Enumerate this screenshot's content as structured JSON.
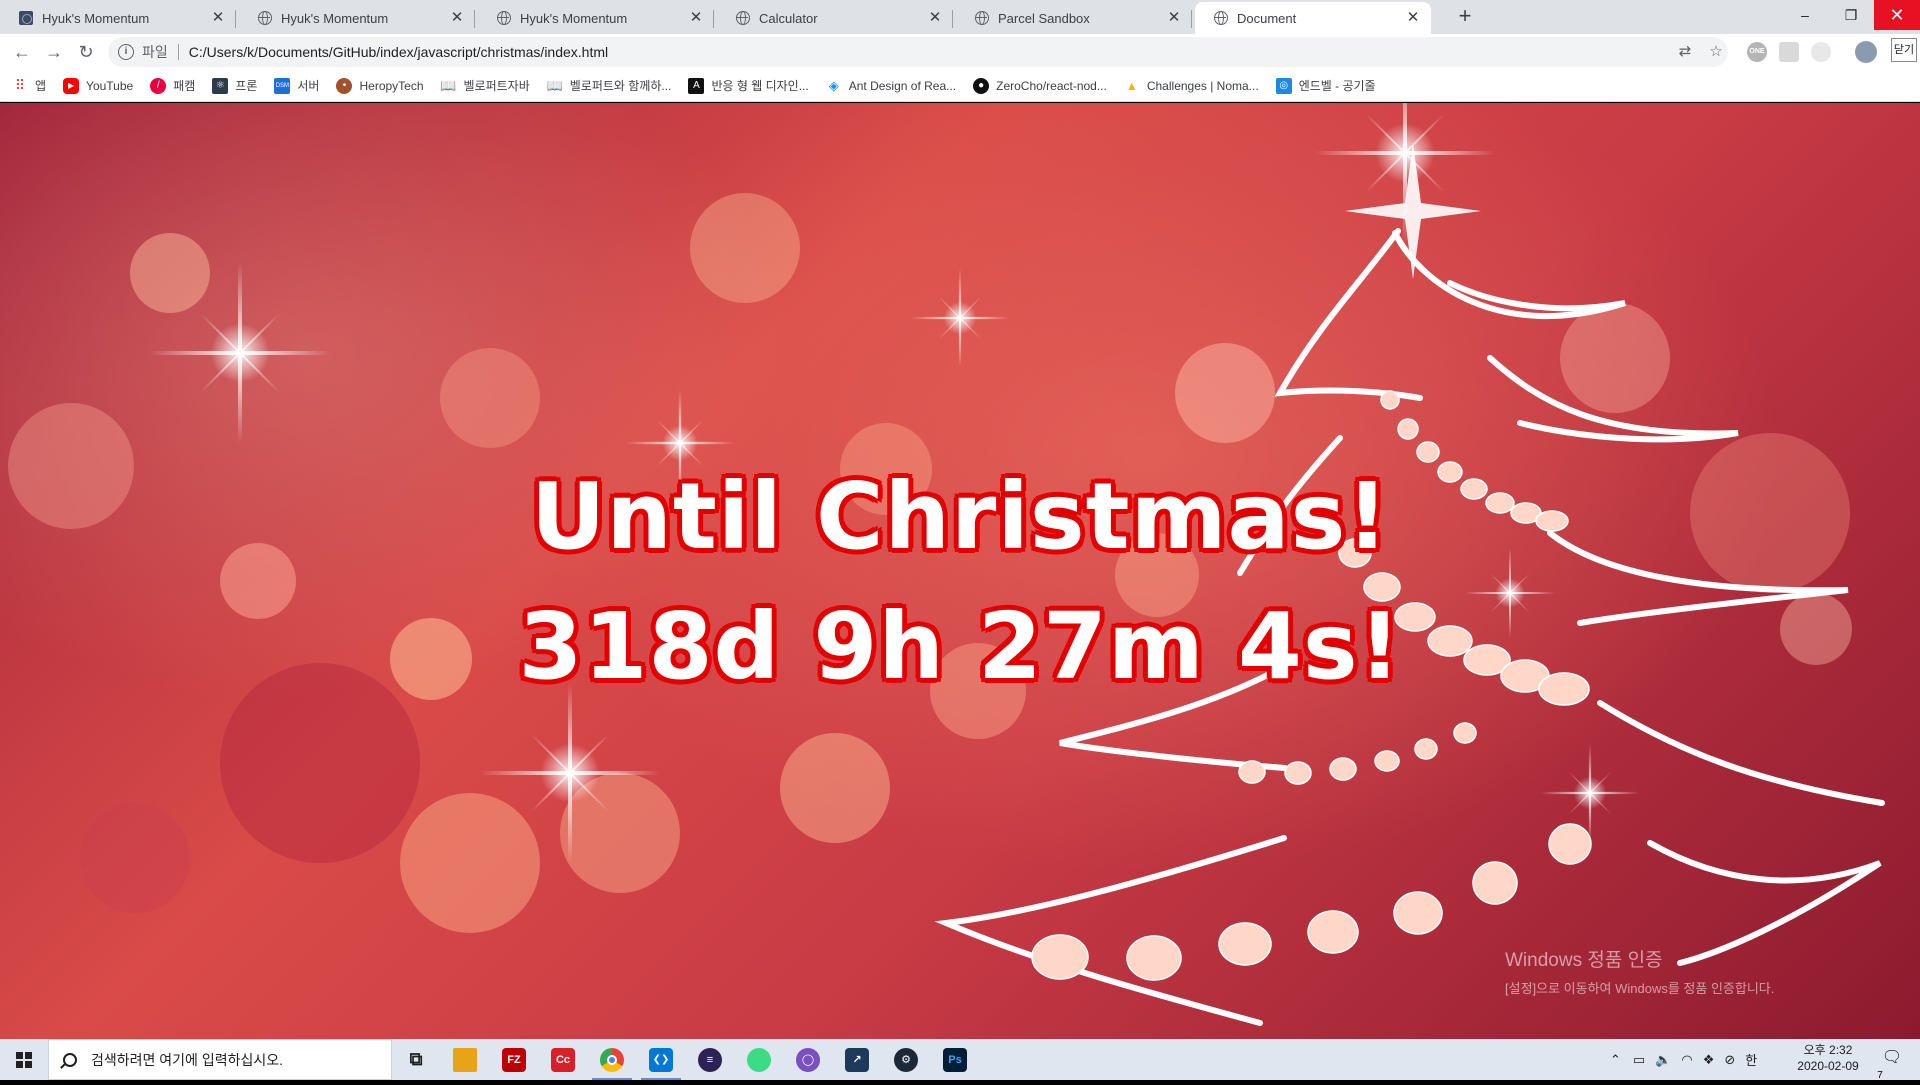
{
  "browser": {
    "tabs": [
      {
        "title": "Hyuk's Momentum",
        "icon": "momentum-icon",
        "active": false
      },
      {
        "title": "Hyuk's Momentum",
        "icon": "globe-icon",
        "active": false
      },
      {
        "title": "Hyuk's Momentum",
        "icon": "globe-icon",
        "active": false
      },
      {
        "title": "Calculator",
        "icon": "globe-icon",
        "active": false
      },
      {
        "title": "Parcel Sandbox",
        "icon": "globe-icon",
        "active": false
      },
      {
        "title": "Document",
        "icon": "globe-icon",
        "active": true
      }
    ],
    "new_tab": "+",
    "window_controls": {
      "minimize": "–",
      "maximize": "❐",
      "close": "✕"
    },
    "address": {
      "scheme_label": "파일",
      "url": "C:/Users/k/Documents/GitHub/index/javascript/christmas/index.html"
    },
    "menu_label": "닫기",
    "bookmarks": [
      {
        "label": "앱",
        "icon": "apps-grid-icon",
        "color": "#ea4335"
      },
      {
        "label": "YouTube",
        "icon": "youtube-icon",
        "color": "#ff0000"
      },
      {
        "label": "패캠",
        "icon": "fastcampus-icon",
        "color": "#e8003d"
      },
      {
        "label": "프론",
        "icon": "react-icon",
        "color": "#2d3b4f"
      },
      {
        "label": "서버",
        "icon": "dsm-icon",
        "color": "#1e6fd9"
      },
      {
        "label": "HeropyTech",
        "icon": "heropy-icon",
        "color": "#a0522d"
      },
      {
        "label": "벨로퍼트자바",
        "icon": "book-icon",
        "color": "#444444"
      },
      {
        "label": "벨로퍼트와 함께하...",
        "icon": "book-icon",
        "color": "#444444"
      },
      {
        "label": "반응 형 웹 디자인...",
        "icon": "adobe-icon",
        "color": "#111111"
      },
      {
        "label": "Ant Design of Rea...",
        "icon": "antdesign-icon",
        "color": "#1890ff"
      },
      {
        "label": "ZeroCho/react-nod...",
        "icon": "github-icon",
        "color": "#111111"
      },
      {
        "label": "Challenges | Noma...",
        "icon": "nomad-icon",
        "color": "#f2b705"
      },
      {
        "label": "엔드벨 - 공기줄",
        "icon": "endbell-icon",
        "color": "#1e88e5"
      }
    ]
  },
  "page": {
    "headline": "Until Christmas!",
    "countdown": "318d 9h 27m 4s!",
    "activation_title": "Windows 정품 인증",
    "activation_sub": "[설정]으로 이동하여 Windows를 정품 인증합니다."
  },
  "taskbar": {
    "search_placeholder": "검색하려면 여기에 입력하십시오.",
    "apps": [
      {
        "name": "task-view-icon",
        "color": "#202020",
        "glyph": "⧉",
        "running": false
      },
      {
        "name": "file-explorer-icon",
        "color": "#e8a317",
        "glyph": "",
        "running": false
      },
      {
        "name": "filezilla-icon",
        "color": "#bf0000",
        "glyph": "FZ",
        "running": false
      },
      {
        "name": "creative-cloud-icon",
        "color": "#da1f26",
        "glyph": "Cc",
        "running": false
      },
      {
        "name": "chrome-icon",
        "color": "#4285f4",
        "glyph": "",
        "running": true
      },
      {
        "name": "vscode-icon",
        "color": "#0078d4",
        "glyph": "❮❯",
        "running": true
      },
      {
        "name": "eclipse-icon",
        "color": "#2c2255",
        "glyph": "",
        "running": false
      },
      {
        "name": "android-studio-icon",
        "color": "#3ddc84",
        "glyph": "",
        "running": false
      },
      {
        "name": "cursor-app-icon",
        "color": "#7a4fbf",
        "glyph": "",
        "running": false
      },
      {
        "name": "netbeans-icon",
        "color": "#1b3a5c",
        "glyph": "",
        "running": false
      },
      {
        "name": "steam-icon",
        "color": "#1b2838",
        "glyph": "",
        "running": false
      },
      {
        "name": "photoshop-icon",
        "color": "#001e36",
        "glyph": "Ps",
        "running": false
      }
    ],
    "ime": "한",
    "time": "오후 2:32",
    "date": "2020-02-09",
    "notification_count": "7"
  }
}
